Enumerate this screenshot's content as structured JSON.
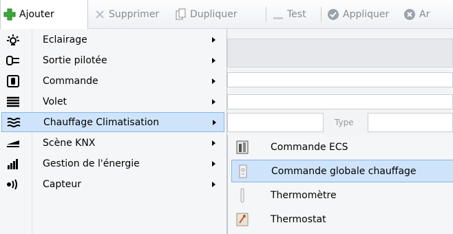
{
  "toolbar": {
    "add_label": "Ajouter",
    "delete_label": "Supprimer",
    "duplicate_label": "Dupliquer",
    "test_label": "Test",
    "apply_label": "Appliquer",
    "cancel_label_partial": "Ar"
  },
  "form": {
    "type_label": "Type"
  },
  "menu": {
    "items": [
      {
        "label": "Eclairage",
        "icon": "light-bulb-icon"
      },
      {
        "label": "Sortie pilotée",
        "icon": "plug-output-icon"
      },
      {
        "label": "Commande",
        "icon": "command-button-icon"
      },
      {
        "label": "Volet",
        "icon": "shutter-icon"
      },
      {
        "label": "Chauffage Climatisation",
        "icon": "heating-icon"
      },
      {
        "label": "Scène KNX",
        "icon": "scene-icon"
      },
      {
        "label": "Gestion de l'énergie",
        "icon": "energy-bars-icon"
      },
      {
        "label": "Capteur",
        "icon": "sensor-icon"
      }
    ]
  },
  "submenu": {
    "items": [
      {
        "label": "Commande ECS",
        "icon": "ecs-tank-icon"
      },
      {
        "label": "Commande globale chauffage",
        "icon": "global-heating-icon"
      },
      {
        "label": "Thermomètre",
        "icon": "thermometer-icon"
      },
      {
        "label": "Thermostat",
        "icon": "thermostat-icon"
      }
    ]
  },
  "colors": {
    "highlight_bg": "#cfe4fa",
    "highlight_border": "#82b7ea",
    "add_green": "#3aa83a"
  }
}
